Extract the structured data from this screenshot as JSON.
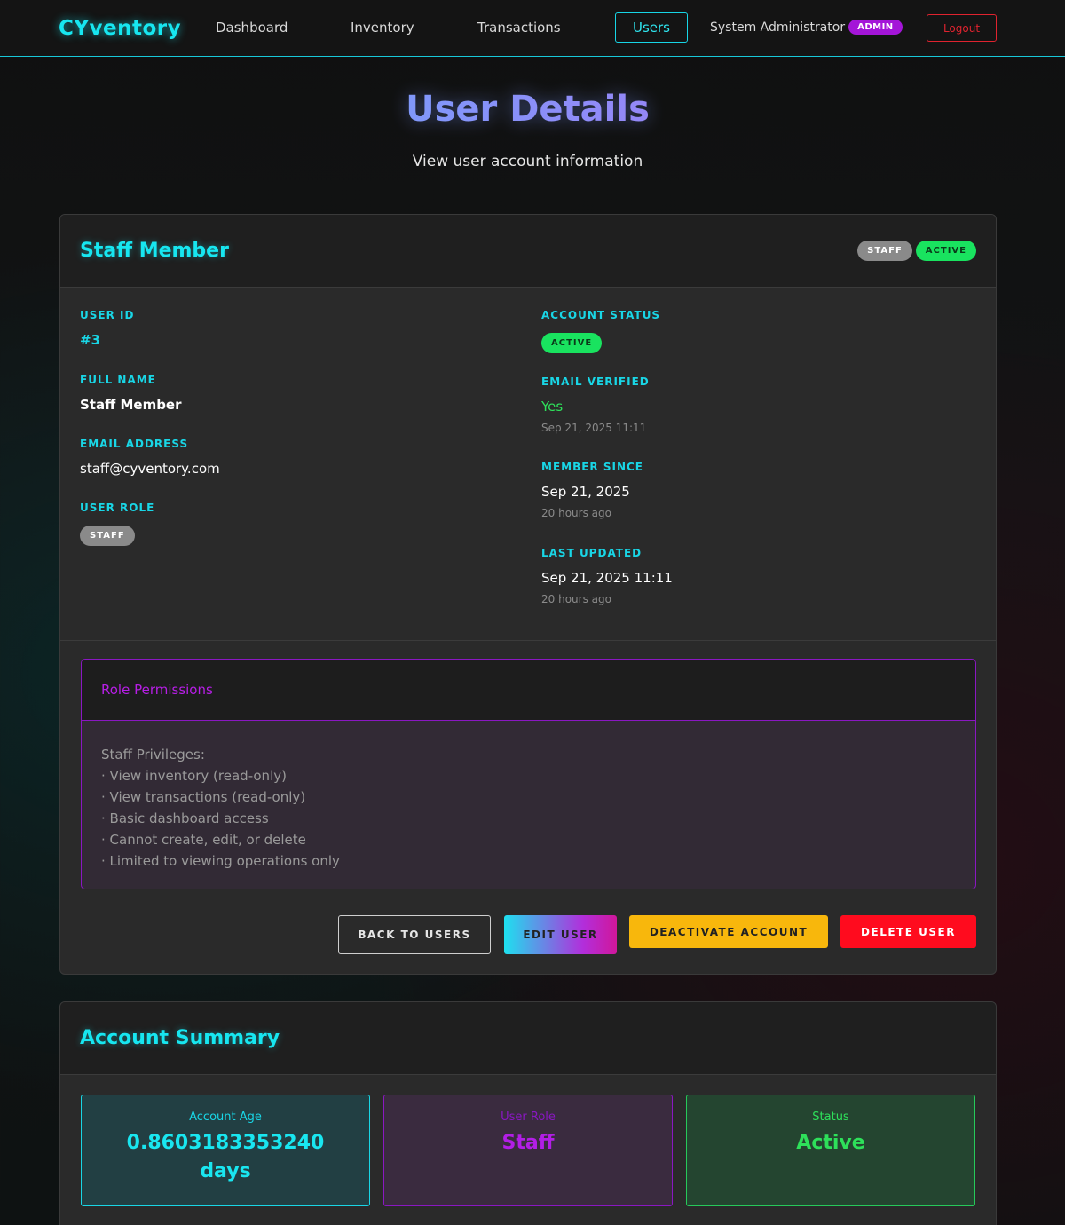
{
  "nav": {
    "brand": "CYventory",
    "links": [
      "Dashboard",
      "Inventory",
      "Transactions",
      "Users"
    ],
    "user_name": "System Administrator",
    "user_badge": "ADMIN",
    "logout": "Logout"
  },
  "header": {
    "title": "User Details",
    "subtitle": "View user account information"
  },
  "user_card": {
    "title": "Staff Member",
    "role_pill": "STAFF",
    "status_pill": "ACTIVE",
    "fields": {
      "user_id_label": "USER ID",
      "user_id": "#3",
      "full_name_label": "FULL NAME",
      "full_name": "Staff Member",
      "email_label": "EMAIL ADDRESS",
      "email": "staff@cyventory.com",
      "role_label": "USER ROLE",
      "role": "STAFF",
      "status_label": "ACCOUNT STATUS",
      "status": "ACTIVE",
      "verified_label": "EMAIL VERIFIED",
      "verified": "Yes",
      "verified_at": "Sep 21, 2025 11:11",
      "member_since_label": "MEMBER SINCE",
      "member_since": "Sep 21, 2025",
      "member_since_ago": "20 hours ago",
      "last_updated_label": "LAST UPDATED",
      "last_updated": "Sep 21, 2025 11:11",
      "last_updated_ago": "20 hours ago"
    },
    "permissions": {
      "title": "Role Permissions",
      "heading": "Staff Privileges:",
      "items": [
        "· View inventory (read-only)",
        "· View transactions (read-only)",
        "· Basic dashboard access",
        "· Cannot create, edit, or delete",
        "· Limited to viewing operations only"
      ]
    },
    "buttons": {
      "back": "BACK TO USERS",
      "edit": "EDIT USER",
      "deactivate": "DEACTIVATE ACCOUNT",
      "delete": "DELETE USER"
    }
  },
  "summary": {
    "title": "Account Summary",
    "account_age_label": "Account Age",
    "account_age": "0.8603183353240",
    "account_age_unit": "days",
    "role_label": "User Role",
    "role": "Staff",
    "status_label": "Status",
    "status": "Active"
  },
  "colors": {
    "accent": "#17e6f0",
    "purple": "#a415d8",
    "success": "#19e35f",
    "danger": "#ff0b1e",
    "warning": "#f8b70c"
  }
}
